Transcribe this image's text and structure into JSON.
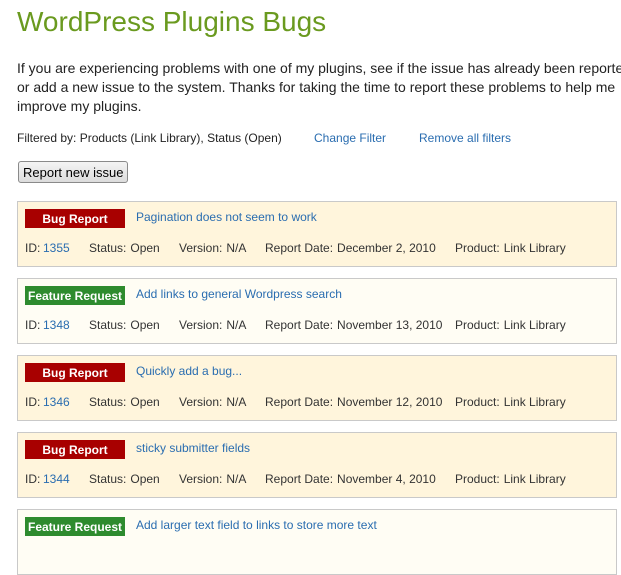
{
  "page": {
    "title": "WordPress Plugins Bugs",
    "intro_lines": [
      "If you are experiencing problems with one of my plugins, see if the issue has already been reported",
      "or add a new issue to the system. Thanks for taking the time to report these problems to help me",
      "improve my plugins."
    ]
  },
  "filter": {
    "text": "Filtered by: Products (Link Library), Status (Open)",
    "change_label": "Change Filter",
    "remove_label": "Remove all filters"
  },
  "report_button": "Report new issue",
  "labels": {
    "id": "ID:",
    "status": "Status:",
    "version": "Version:",
    "report_date": "Report Date:",
    "product": "Product:"
  },
  "issues": [
    {
      "type": "Bug Report",
      "kind": "bug",
      "title": "Pagination does not seem to work",
      "id": "1355",
      "status": "Open",
      "version": "N/A",
      "date": "December 2, 2010",
      "product": "Link Library"
    },
    {
      "type": "Feature Request",
      "kind": "feature",
      "title": "Add links to general Wordpress search",
      "id": "1348",
      "status": "Open",
      "version": "N/A",
      "date": "November 13, 2010",
      "product": "Link Library"
    },
    {
      "type": "Bug Report",
      "kind": "bug",
      "title": "Quickly add a bug...",
      "id": "1346",
      "status": "Open",
      "version": "N/A",
      "date": "November 12, 2010",
      "product": "Link Library"
    },
    {
      "type": "Bug Report",
      "kind": "bug",
      "title": "sticky submitter fields",
      "id": "1344",
      "status": "Open",
      "version": "N/A",
      "date": "November 4, 2010",
      "product": "Link Library"
    },
    {
      "type": "Feature Request",
      "kind": "feature",
      "title": "Add larger text field to links to store more text",
      "id": "",
      "status": "",
      "version": "",
      "date": "",
      "product": ""
    }
  ],
  "colors": {
    "title_green": "#6a9a1f",
    "link_blue": "#2a6db0",
    "bug_red": "#a80000",
    "feature_green": "#2e8b2e"
  }
}
